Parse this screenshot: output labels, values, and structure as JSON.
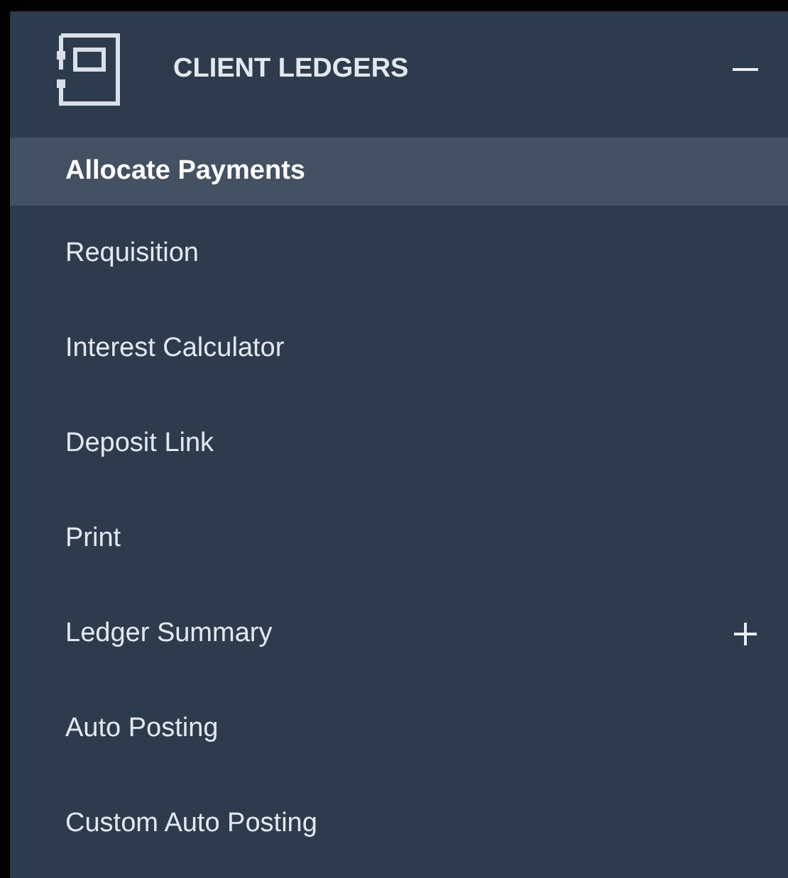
{
  "section": {
    "title": "CLIENT LEDGERS",
    "expanded": true
  },
  "items": [
    {
      "label": "Allocate Payments",
      "selected": true
    },
    {
      "label": "Requisition",
      "selected": false
    },
    {
      "label": "Interest Calculator",
      "selected": false
    },
    {
      "label": "Deposit Link",
      "selected": false
    },
    {
      "label": "Print",
      "selected": false
    },
    {
      "label": "Ledger Summary",
      "selected": false,
      "expanded": false
    },
    {
      "label": "Auto Posting",
      "selected": false
    },
    {
      "label": "Custom Auto Posting",
      "selected": false
    }
  ]
}
